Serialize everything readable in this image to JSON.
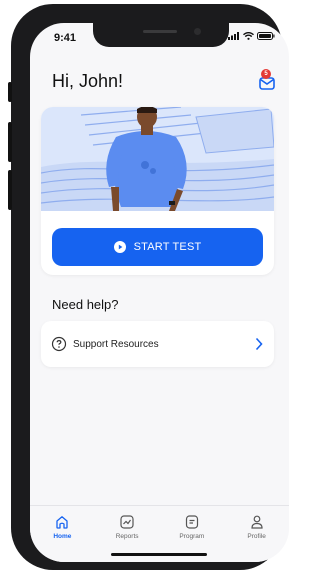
{
  "status": {
    "time": "9:41"
  },
  "header": {
    "greeting": "Hi, John!",
    "mail_badge": "5"
  },
  "test_card": {
    "button_label": "START TEST"
  },
  "help": {
    "title": "Need help?",
    "support_label": "Support Resources"
  },
  "nav": {
    "items": [
      {
        "label": "Home",
        "icon": "home-icon",
        "active": true
      },
      {
        "label": "Reports",
        "icon": "reports-icon",
        "active": false
      },
      {
        "label": "Program",
        "icon": "program-icon",
        "active": false
      },
      {
        "label": "Profile",
        "icon": "profile-icon",
        "active": false
      }
    ]
  },
  "colors": {
    "primary": "#1663f0",
    "background": "#f7f7f9",
    "badge": "#e53935",
    "illustration_bg": "#dbe6fb"
  }
}
